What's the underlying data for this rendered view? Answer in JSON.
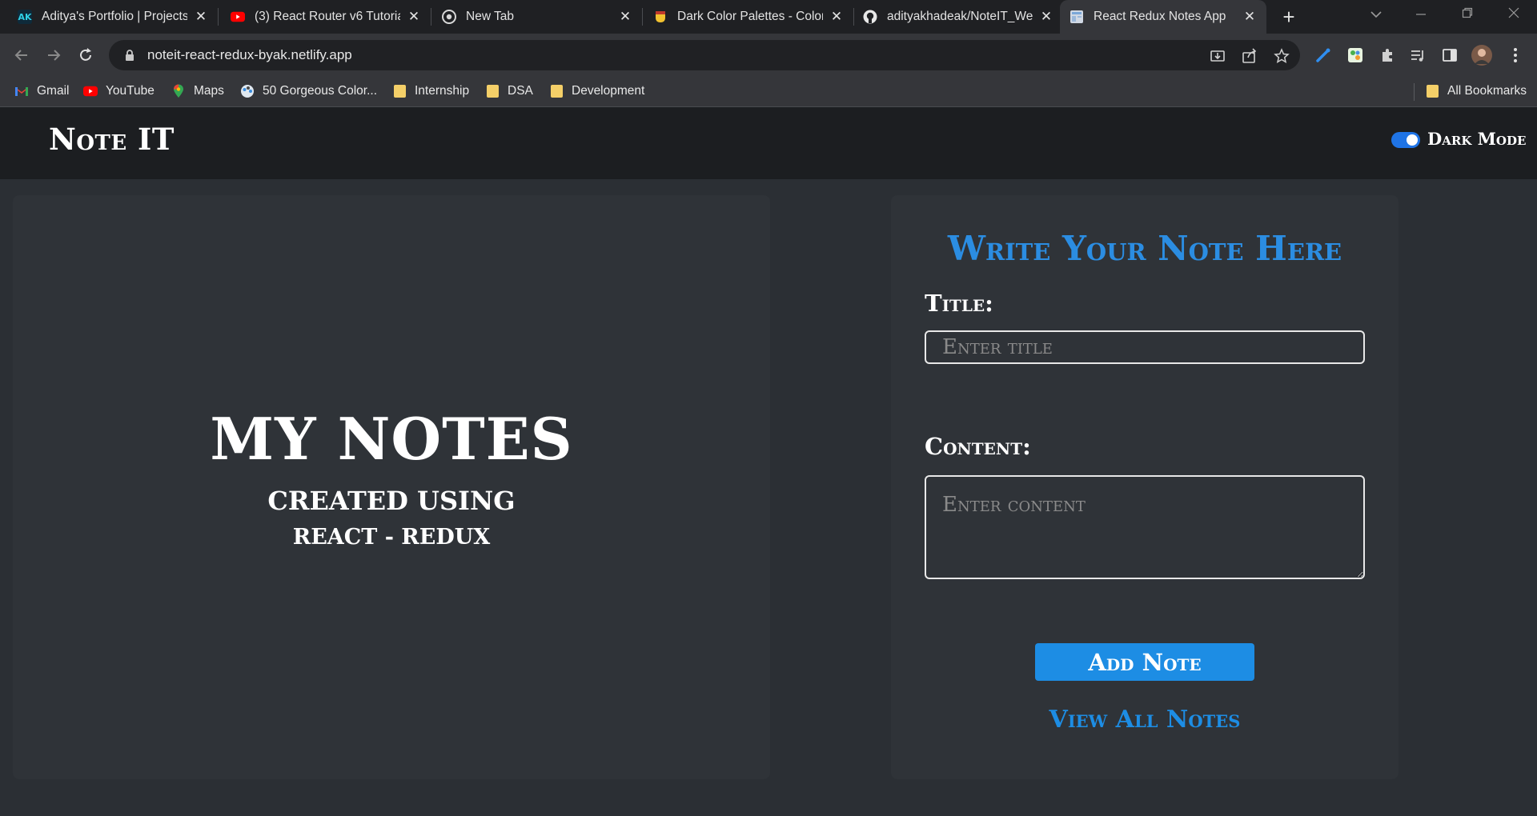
{
  "browser": {
    "tabs": [
      {
        "label": "Aditya's Portfolio | Projects",
        "icon": "portfolio-favicon"
      },
      {
        "label": "(3) React Router v6 Tutorial",
        "icon": "youtube-favicon"
      },
      {
        "label": "New Tab",
        "icon": "chrome-favicon"
      },
      {
        "label": "Dark Color Palettes - Color",
        "icon": "palette-favicon"
      },
      {
        "label": "adityakhadeak/NoteIT_Web",
        "icon": "github-favicon"
      },
      {
        "label": "React Redux Notes App",
        "icon": "document-favicon",
        "active": true
      }
    ],
    "url": "noteit-react-redux-byak.netlify.app",
    "bookmarks": [
      {
        "label": "Gmail",
        "icon": "gmail-icon"
      },
      {
        "label": "YouTube",
        "icon": "youtube-icon"
      },
      {
        "label": "Maps",
        "icon": "maps-icon"
      },
      {
        "label": "50 Gorgeous Color...",
        "icon": "palette-icon"
      },
      {
        "label": "Internship",
        "icon": "folder-icon"
      },
      {
        "label": "DSA",
        "icon": "folder-icon"
      },
      {
        "label": "Development",
        "icon": "folder-icon"
      }
    ],
    "all_bookmarks_label": "All Bookmarks"
  },
  "app": {
    "brand": "Note IT",
    "dark_mode_label": "Dark Mode",
    "dark_mode_on": true,
    "hero": {
      "title": "MY NOTES",
      "subtitle": "CREATED USING",
      "tech": "REACT - REDUX"
    },
    "form": {
      "heading": "Write Your Note Here",
      "title_label": "Title:",
      "title_placeholder": "Enter title",
      "content_label": "Content:",
      "content_placeholder": "Enter content",
      "add_button": "Add Note",
      "view_all_link": "View All Notes"
    }
  },
  "colors": {
    "accent": "#1d8de4",
    "page_bg": "#2b2f34",
    "navbar_bg": "#1c1e21",
    "toggle_on": "#1f74e6"
  }
}
